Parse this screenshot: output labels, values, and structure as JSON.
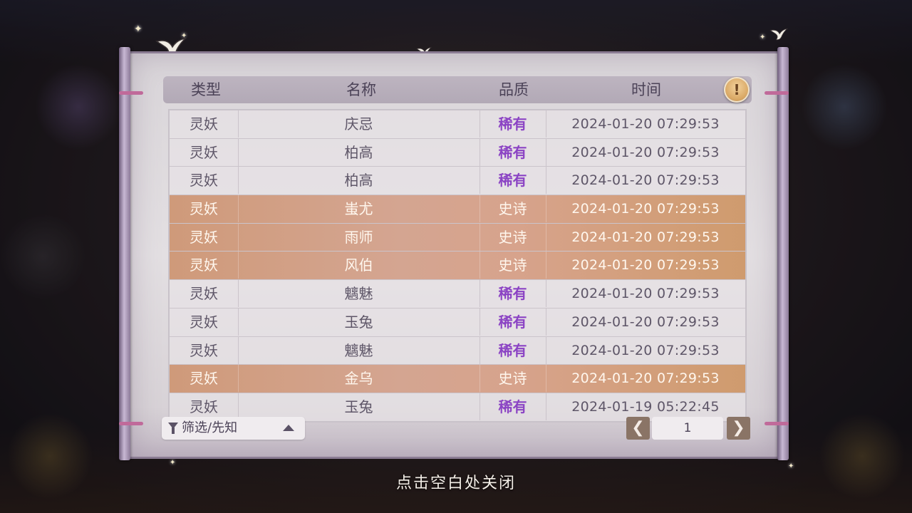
{
  "header": {
    "col_type": "类型",
    "col_name": "名称",
    "col_quality": "品质",
    "col_time": "时间",
    "info_icon": "exclamation-icon"
  },
  "colors": {
    "rare": "#8b43c4",
    "epic_row": "#d4a591"
  },
  "rows": [
    {
      "type": "灵妖",
      "name": "庆忌",
      "quality": "稀有",
      "time": "2024-01-20  07:29:53",
      "epic": false
    },
    {
      "type": "灵妖",
      "name": "柏高",
      "quality": "稀有",
      "time": "2024-01-20  07:29:53",
      "epic": false
    },
    {
      "type": "灵妖",
      "name": "柏高",
      "quality": "稀有",
      "time": "2024-01-20  07:29:53",
      "epic": false
    },
    {
      "type": "灵妖",
      "name": "蚩尤",
      "quality": "史诗",
      "time": "2024-01-20  07:29:53",
      "epic": true
    },
    {
      "type": "灵妖",
      "name": "雨师",
      "quality": "史诗",
      "time": "2024-01-20  07:29:53",
      "epic": true
    },
    {
      "type": "灵妖",
      "name": "风伯",
      "quality": "史诗",
      "time": "2024-01-20  07:29:53",
      "epic": true
    },
    {
      "type": "灵妖",
      "name": "魑魅",
      "quality": "稀有",
      "time": "2024-01-20  07:29:53",
      "epic": false
    },
    {
      "type": "灵妖",
      "name": "玉兔",
      "quality": "稀有",
      "time": "2024-01-20  07:29:53",
      "epic": false
    },
    {
      "type": "灵妖",
      "name": "魑魅",
      "quality": "稀有",
      "time": "2024-01-20  07:29:53",
      "epic": false
    },
    {
      "type": "灵妖",
      "name": "金乌",
      "quality": "史诗",
      "time": "2024-01-20  07:29:53",
      "epic": true
    },
    {
      "type": "灵妖",
      "name": "玉兔",
      "quality": "稀有",
      "time": "2024-01-19  05:22:45",
      "epic": false
    }
  ],
  "filter": {
    "label": "筛选/先知",
    "icon": "funnel-icon",
    "arrow": "triangle-up-icon"
  },
  "pagination": {
    "prev": "❮",
    "page": "1",
    "next": "❯"
  },
  "close_hint": "点击空白处关闭"
}
